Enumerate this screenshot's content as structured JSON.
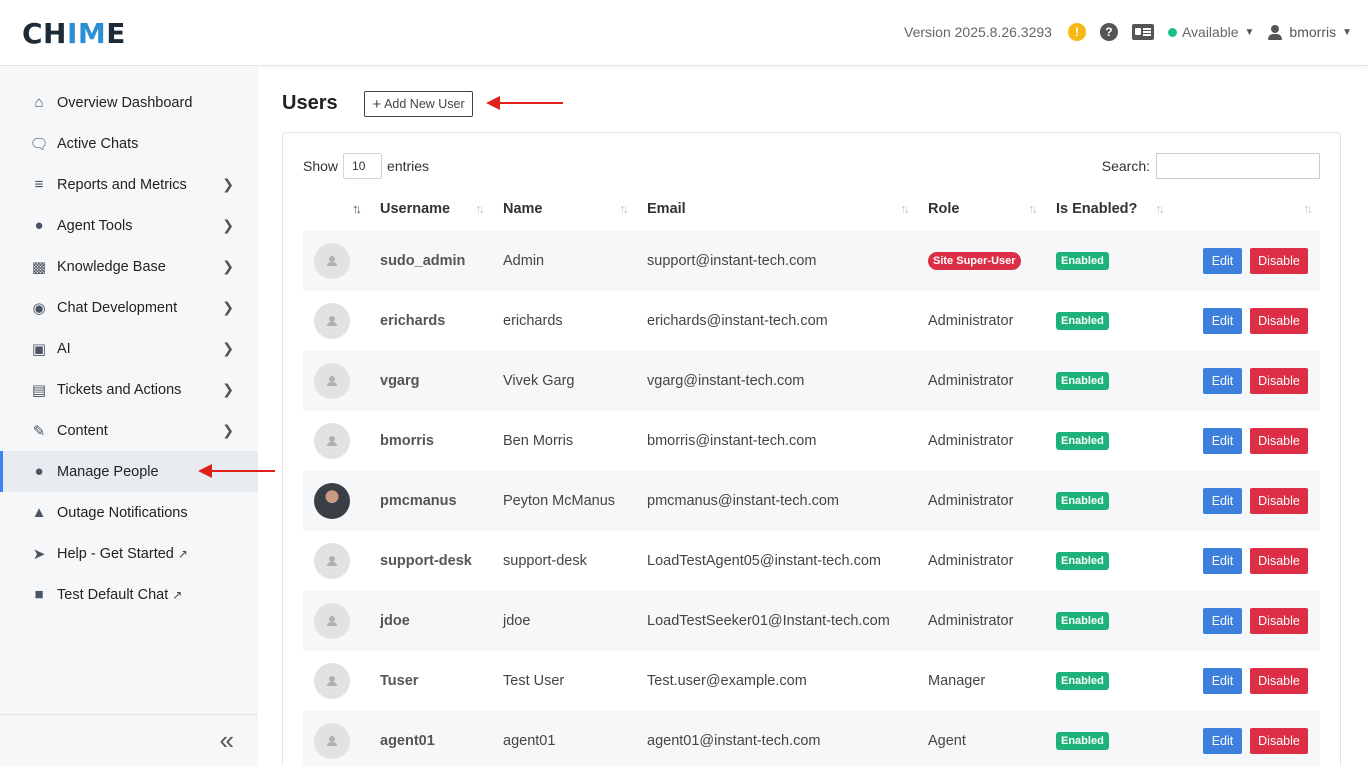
{
  "app": {
    "logo_prefix": "CH",
    "logo_highlight": "IM",
    "logo_suffix": "E",
    "version": "Version 2025.8.26.3293",
    "status": "Available",
    "username": "bmorris"
  },
  "sidebar": {
    "items": [
      {
        "label": "Overview Dashboard",
        "icon": "home-icon"
      },
      {
        "label": "Active Chats",
        "icon": "comments-icon"
      },
      {
        "label": "Reports and Metrics",
        "icon": "chart-icon"
      },
      {
        "label": "Agent Tools",
        "icon": "users-icon"
      },
      {
        "label": "Knowledge Base",
        "icon": "book-icon"
      },
      {
        "label": "Chat Development",
        "icon": "comment-icon"
      },
      {
        "label": "AI",
        "icon": "robot-icon"
      },
      {
        "label": "Tickets and Actions",
        "icon": "ticket-icon"
      },
      {
        "label": "Content",
        "icon": "edit-icon"
      },
      {
        "label": "Manage People",
        "icon": "user-icon"
      },
      {
        "label": "Outage Notifications",
        "icon": "warning-icon"
      },
      {
        "label": "Help - Get Started",
        "icon": "rocket-icon"
      },
      {
        "label": "Test Default Chat",
        "icon": "chat-square-icon"
      }
    ],
    "active": "Manage People"
  },
  "main": {
    "title": "Users",
    "add_button": "Add New User",
    "show_label": "Show",
    "entries_value": "10",
    "entries_label": "entries",
    "search_label": "Search:"
  },
  "table": {
    "columns": [
      "Username",
      "Name",
      "Email",
      "Role",
      "Is Enabled?"
    ],
    "edit_label": "Edit",
    "disable_label": "Disable",
    "rows": [
      {
        "username": "sudo_admin",
        "name": "Admin",
        "email": "support@instant-tech.com",
        "role": "Site Super-User",
        "enabled": "Enabled",
        "photo": false
      },
      {
        "username": "erichards",
        "name": "erichards",
        "email": "erichards@instant-tech.com",
        "role": "Administrator",
        "enabled": "Enabled",
        "photo": false
      },
      {
        "username": "vgarg",
        "name": "Vivek Garg",
        "email": "vgarg@instant-tech.com",
        "role": "Administrator",
        "enabled": "Enabled",
        "photo": false
      },
      {
        "username": "bmorris",
        "name": "Ben Morris",
        "email": "bmorris@instant-tech.com",
        "role": "Administrator",
        "enabled": "Enabled",
        "photo": false
      },
      {
        "username": "pmcmanus",
        "name": "Peyton McManus",
        "email": "pmcmanus@instant-tech.com",
        "role": "Administrator",
        "enabled": "Enabled",
        "photo": true
      },
      {
        "username": "support-desk",
        "name": "support-desk",
        "email": "LoadTestAgent05@instant-tech.com",
        "role": "Administrator",
        "enabled": "Enabled",
        "photo": false
      },
      {
        "username": "jdoe",
        "name": "jdoe",
        "email": "LoadTestSeeker01@Instant-tech.com",
        "role": "Administrator",
        "enabled": "Enabled",
        "photo": false
      },
      {
        "username": "Tuser",
        "name": "Test User",
        "email": "Test.user@example.com",
        "role": "Manager",
        "enabled": "Enabled",
        "photo": false
      },
      {
        "username": "agent01",
        "name": "agent01",
        "email": "agent01@instant-tech.com",
        "role": "Agent",
        "enabled": "Enabled",
        "photo": false
      }
    ]
  },
  "colors": {
    "accent": "#3b82f6",
    "enabled_badge": "#1cb27a",
    "danger": "#dc2e45",
    "edit": "#3d7fdc",
    "annotation_arrow": "#e0201b"
  }
}
